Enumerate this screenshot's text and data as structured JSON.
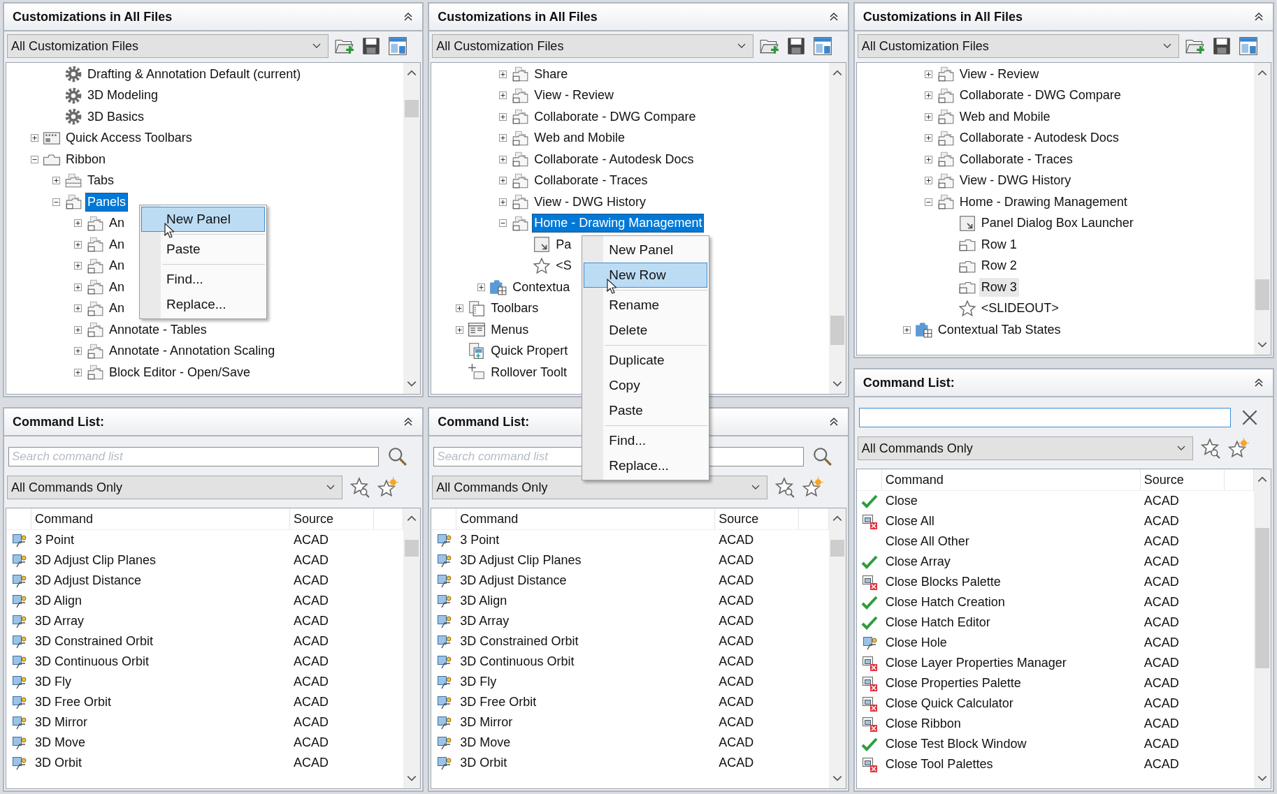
{
  "panels": [
    {
      "customizations": {
        "title": "Customizations in All Files",
        "file_filter": "All Customization Files",
        "tree": [
          {
            "children": [
              {
                "children": [
                  {
                    "label": "Drafting & Annotation Default (current)",
                    "kind": "workspace",
                    "selected": false
                  },
                  {
                    "label": "3D Modeling",
                    "kind": "workspace",
                    "selected": false
                  },
                  {
                    "label": "3D Basics",
                    "kind": "workspace",
                    "selected": false
                  }
                ]
              },
              {
                "label": "Quick Access Toolbars",
                "kind": "toolbar",
                "expanded": false,
                "selected": false
              },
              {
                "label": "Ribbon",
                "kind": "ribbon",
                "expanded": true,
                "selected": false,
                "children": [
                  {
                    "label": "Tabs",
                    "kind": "tabs",
                    "expanded": false,
                    "selected": false
                  },
                  {
                    "label": "Panels",
                    "kind": "panel",
                    "expanded": true,
                    "selected": true,
                    "children": [
                      {
                        "label": "An",
                        "kind": "panel",
                        "expanded": false,
                        "selected": false
                      },
                      {
                        "label": "An",
                        "kind": "panel",
                        "expanded": false,
                        "selected": false
                      },
                      {
                        "label": "An",
                        "kind": "panel",
                        "expanded": false,
                        "selected": false
                      },
                      {
                        "label": "An",
                        "kind": "panel",
                        "expanded": false,
                        "selected": false
                      },
                      {
                        "label": "An",
                        "kind": "panel",
                        "expanded": false,
                        "selected": false
                      },
                      {
                        "label": "Annotate - Tables",
                        "kind": "panel",
                        "expanded": false,
                        "selected": false
                      },
                      {
                        "label": "Annotate - Annotation Scaling",
                        "kind": "panel",
                        "expanded": false,
                        "selected": false
                      },
                      {
                        "label": "Block Editor - Open/Save",
                        "kind": "panel",
                        "expanded": false,
                        "selected": false
                      }
                    ]
                  }
                ]
              }
            ]
          }
        ],
        "context_menu": {
          "groups": [
            [
              {
                "label": "New Panel",
                "selected": true
              }
            ],
            [
              {
                "label": "Paste",
                "selected": false
              }
            ],
            [
              {
                "label": "Find...",
                "selected": false
              },
              {
                "label": "Replace...",
                "selected": false
              }
            ]
          ]
        }
      },
      "command_list": {
        "title": "Command List:",
        "search": {
          "kind": "search",
          "placeholder": "Search command list",
          "focused": false
        },
        "filter": "All Commands Only",
        "columns": [
          "Command",
          "Source"
        ],
        "rows": [
          {
            "kind": "tool",
            "command": "3 Point",
            "source": "ACAD"
          },
          {
            "kind": "tool",
            "command": "3D Adjust Clip Planes",
            "source": "ACAD"
          },
          {
            "kind": "tool",
            "command": "3D Adjust Distance",
            "source": "ACAD"
          },
          {
            "kind": "tool",
            "command": "3D Align",
            "source": "ACAD"
          },
          {
            "kind": "tool",
            "command": "3D Array",
            "source": "ACAD"
          },
          {
            "kind": "tool",
            "command": "3D Constrained Orbit",
            "source": "ACAD"
          },
          {
            "kind": "tool",
            "command": "3D Continuous Orbit",
            "source": "ACAD"
          },
          {
            "kind": "tool",
            "command": "3D Fly",
            "source": "ACAD"
          },
          {
            "kind": "tool",
            "command": "3D Free Orbit",
            "source": "ACAD"
          },
          {
            "kind": "tool",
            "command": "3D Mirror",
            "source": "ACAD"
          },
          {
            "kind": "tool",
            "command": "3D Move",
            "source": "ACAD"
          },
          {
            "kind": "tool",
            "command": "3D Orbit",
            "source": "ACAD"
          }
        ]
      }
    },
    {
      "customizations": {
        "title": "Customizations in All Files",
        "file_filter": "All Customization Files",
        "tree": [
          {
            "children": [
              {
                "children": [
                  {
                    "children": [
                      {
                        "label": "Share",
                        "kind": "panel",
                        "expanded": false,
                        "selected": false
                      },
                      {
                        "label": "View - Review",
                        "kind": "panel",
                        "expanded": false,
                        "selected": false
                      },
                      {
                        "label": "Collaborate - DWG Compare",
                        "kind": "panel",
                        "expanded": false,
                        "selected": false
                      },
                      {
                        "label": "Web and Mobile",
                        "kind": "panel",
                        "expanded": false,
                        "selected": false
                      },
                      {
                        "label": "Collaborate - Autodesk Docs",
                        "kind": "panel",
                        "expanded": false,
                        "selected": false
                      },
                      {
                        "label": "Collaborate - Traces",
                        "kind": "panel",
                        "expanded": false,
                        "selected": false
                      },
                      {
                        "label": "View - DWG History",
                        "kind": "panel",
                        "expanded": false,
                        "selected": false
                      },
                      {
                        "label": "Home - Drawing Management",
                        "kind": "panel",
                        "expanded": true,
                        "selected": true,
                        "children": [
                          {
                            "label": "Pa",
                            "kind": "launcher",
                            "selected": false
                          },
                          {
                            "label": "<S",
                            "kind": "slideout",
                            "selected": false
                          }
                        ]
                      }
                    ]
                  },
                  {
                    "label": "Contextua",
                    "kind": "contextual",
                    "expanded": false,
                    "selected": false
                  }
                ]
              },
              {
                "label": "Toolbars",
                "kind": "toolbars",
                "expanded": false,
                "selected": false
              },
              {
                "label": "Menus",
                "kind": "menus",
                "expanded": false,
                "selected": false
              },
              {
                "label": "Quick Propert",
                "kind": "properties",
                "selected": false
              },
              {
                "label": "Rollover Toolt",
                "kind": "rollover",
                "selected": false
              }
            ]
          }
        ],
        "context_menu": {
          "groups": [
            [
              {
                "label": "New Panel",
                "selected": false
              },
              {
                "label": "New Row",
                "selected": true
              }
            ],
            [
              {
                "label": "Rename",
                "selected": false
              },
              {
                "label": "Delete",
                "selected": false
              }
            ],
            [
              {
                "label": "Duplicate",
                "selected": false
              },
              {
                "label": "Copy",
                "selected": false
              },
              {
                "label": "Paste",
                "selected": false
              }
            ],
            [
              {
                "label": "Find...",
                "selected": false
              },
              {
                "label": "Replace...",
                "selected": false
              }
            ]
          ]
        }
      },
      "command_list": {
        "title": "Command List:",
        "search": {
          "kind": "search",
          "placeholder": "Search command list",
          "focused": false
        },
        "filter": "All Commands Only",
        "columns": [
          "Command",
          "Source"
        ],
        "rows": [
          {
            "kind": "tool",
            "command": "3 Point",
            "source": "ACAD"
          },
          {
            "kind": "tool",
            "command": "3D Adjust Clip Planes",
            "source": "ACAD"
          },
          {
            "kind": "tool",
            "command": "3D Adjust Distance",
            "source": "ACAD"
          },
          {
            "kind": "tool",
            "command": "3D Align",
            "source": "ACAD"
          },
          {
            "kind": "tool",
            "command": "3D Array",
            "source": "ACAD"
          },
          {
            "kind": "tool",
            "command": "3D Constrained Orbit",
            "source": "ACAD"
          },
          {
            "kind": "tool",
            "command": "3D Continuous Orbit",
            "source": "ACAD"
          },
          {
            "kind": "tool",
            "command": "3D Fly",
            "source": "ACAD"
          },
          {
            "kind": "tool",
            "command": "3D Free Orbit",
            "source": "ACAD"
          },
          {
            "kind": "tool",
            "command": "3D Mirror",
            "source": "ACAD"
          },
          {
            "kind": "tool",
            "command": "3D Move",
            "source": "ACAD"
          },
          {
            "kind": "tool",
            "command": "3D Orbit",
            "source": "ACAD"
          }
        ]
      }
    },
    {
      "customizations": {
        "title": "Customizations in All Files",
        "file_filter": "All Customization Files",
        "tree": [
          {
            "children": [
              {
                "children": [
                  {
                    "children": [
                      {
                        "label": "View - Review",
                        "kind": "panel",
                        "expanded": false,
                        "selected": false
                      },
                      {
                        "label": "Collaborate - DWG Compare",
                        "kind": "panel",
                        "expanded": false,
                        "selected": false
                      },
                      {
                        "label": "Web and Mobile",
                        "kind": "panel",
                        "expanded": false,
                        "selected": false
                      },
                      {
                        "label": "Collaborate - Autodesk Docs",
                        "kind": "panel",
                        "expanded": false,
                        "selected": false
                      },
                      {
                        "label": "Collaborate - Traces",
                        "kind": "panel",
                        "expanded": false,
                        "selected": false
                      },
                      {
                        "label": "View - DWG History",
                        "kind": "panel",
                        "expanded": false,
                        "selected": false
                      },
                      {
                        "label": "Home - Drawing Management",
                        "kind": "panel",
                        "expanded": true,
                        "selected": false,
                        "children": [
                          {
                            "label": "Panel Dialog Box Launcher",
                            "kind": "launcher",
                            "selected": false
                          },
                          {
                            "label": "Row 1",
                            "kind": "row",
                            "selected": false
                          },
                          {
                            "label": "Row 2",
                            "kind": "row",
                            "selected": false
                          },
                          {
                            "label": "Row 3",
                            "kind": "row",
                            "selected": false,
                            "hovered": true
                          },
                          {
                            "label": "<SLIDEOUT>",
                            "kind": "slideout",
                            "selected": false
                          }
                        ]
                      }
                    ]
                  },
                  {
                    "label": "Contextual Tab States",
                    "kind": "contextual",
                    "expanded": false,
                    "selected": false
                  }
                ]
              }
            ]
          }
        ]
      },
      "command_list": {
        "title": "Command List:",
        "search": {
          "kind": "clear",
          "focused": true
        },
        "filter": "All Commands Only",
        "columns": [
          "Command",
          "Source"
        ],
        "rows": [
          {
            "kind": "check",
            "command": "Close",
            "source": "ACAD"
          },
          {
            "kind": "close",
            "command": "Close All",
            "source": "ACAD"
          },
          {
            "kind": "blank",
            "command": "Close All Other",
            "source": "ACAD"
          },
          {
            "kind": "check",
            "command": "Close Array",
            "source": "ACAD"
          },
          {
            "kind": "close",
            "command": "Close Blocks Palette",
            "source": "ACAD"
          },
          {
            "kind": "check",
            "command": "Close Hatch Creation",
            "source": "ACAD"
          },
          {
            "kind": "check",
            "command": "Close Hatch Editor",
            "source": "ACAD"
          },
          {
            "kind": "tool",
            "command": "Close Hole",
            "source": "ACAD"
          },
          {
            "kind": "close",
            "command": "Close Layer Properties Manager",
            "source": "ACAD"
          },
          {
            "kind": "close",
            "command": "Close Properties Palette",
            "source": "ACAD"
          },
          {
            "kind": "close",
            "command": "Close Quick Calculator",
            "source": "ACAD"
          },
          {
            "kind": "close",
            "command": "Close Ribbon",
            "source": "ACAD"
          },
          {
            "kind": "check",
            "command": "Close Test Block Window",
            "source": "ACAD"
          },
          {
            "kind": "close",
            "command": "Close Tool Palettes",
            "source": "ACAD"
          }
        ]
      }
    }
  ]
}
